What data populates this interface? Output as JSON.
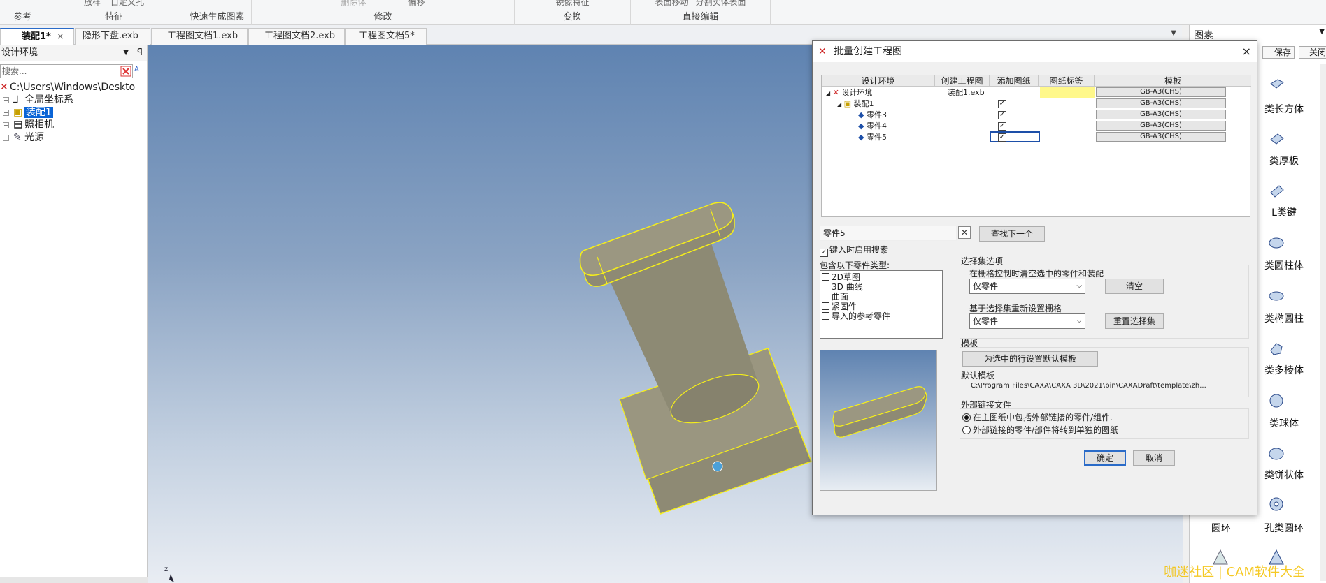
{
  "ribbon": {
    "top_items": [
      "放样",
      "自定义孔",
      "特征",
      "删除体",
      "偏移",
      "镜像特征",
      "表面移动",
      "分割实体表面"
    ],
    "groups": [
      "参考",
      "特征",
      "快速生成图素",
      "修改",
      "变换",
      "直接编辑"
    ]
  },
  "tabs": [
    {
      "label": "装配1*",
      "active": true,
      "close": "×"
    },
    {
      "label": "隐形下盘.exb"
    },
    {
      "label": "工程图文档1.exb"
    },
    {
      "label": "工程图文档2.exb"
    },
    {
      "label": "工程图文档5*"
    }
  ],
  "left_panel": {
    "title": "设计环境",
    "pin": "ꟼ",
    "search_placeholder": "搜索...",
    "tree": [
      {
        "label": "C:\\Users\\Windows\\Deskto"
      },
      {
        "label": "全局坐标系"
      },
      {
        "label": "装配1",
        "selected": true
      },
      {
        "label": "照相机"
      },
      {
        "label": "光源"
      }
    ]
  },
  "right_panel": {
    "title": "图素",
    "save": "保存",
    "close": "关闭",
    "items": [
      "类长方体",
      "类厚板",
      "L类键",
      "类圆柱体",
      "类椭圆柱",
      "类多棱体",
      "类球体",
      "类饼状体",
      "圆环",
      "孔类圆环"
    ]
  },
  "viewport": {
    "axis_label": "z"
  },
  "dialog": {
    "title": "批量创建工程图",
    "close": "×",
    "grid": {
      "headers": [
        "设计环境",
        "创建工程图",
        "添加图纸",
        "图纸标签",
        "模板"
      ],
      "rows": [
        {
          "name": "设计环境",
          "file": "装配1.exb",
          "checked": false,
          "template": "GB-A3(CHS)"
        },
        {
          "name": "装配1",
          "file": "",
          "checked": true,
          "template": "GB-A3(CHS)"
        },
        {
          "name": "零件3",
          "file": "",
          "checked": true,
          "template": "GB-A3(CHS)"
        },
        {
          "name": "零件4",
          "file": "",
          "checked": true,
          "template": "GB-A3(CHS)"
        },
        {
          "name": "零件5",
          "file": "",
          "checked": true,
          "template": "GB-A3(CHS)"
        }
      ]
    },
    "search_value": "零件5",
    "find_next": "查找下一个",
    "search_on_type": "键入时启用搜索",
    "include_types_label": "包含以下零件类型:",
    "include_types": [
      "2D草图",
      "3D 曲线",
      "曲面",
      "紧固件",
      "导入的参考零件"
    ],
    "selection_options": "选择集选项",
    "clear_group_label": "在栅格控制时清空选中的零件和装配",
    "clear_select_value": "仅零件",
    "clear_button": "清空",
    "reset_group_label": "基于选择集重新设置栅格",
    "reset_select_value": "仅零件",
    "reset_button": "重置选择集",
    "template_label": "模板",
    "set_default_template_button": "为选中的行设置默认模板",
    "default_template_label": "默认模板",
    "default_template_path": "C:\\Program Files\\CAXA\\CAXA 3D\\2021\\bin\\CAXADraft\\template\\zh...",
    "external_links_label": "外部链接文件",
    "radio_include": "在主图纸中包括外部链接的零件/组件.",
    "radio_separate": "外部链接的零件/部件将转到单独的图纸",
    "ok": "确定",
    "cancel": "取消"
  },
  "watermark": "咖迷社区 | CAM软件大全",
  "colors": {
    "accent": "#2a6bc8",
    "selection": "#0a64d6",
    "part_fill": "#8e8a74",
    "part_edge": "#f5ee1a",
    "tag_highlight": "#fff88a"
  }
}
